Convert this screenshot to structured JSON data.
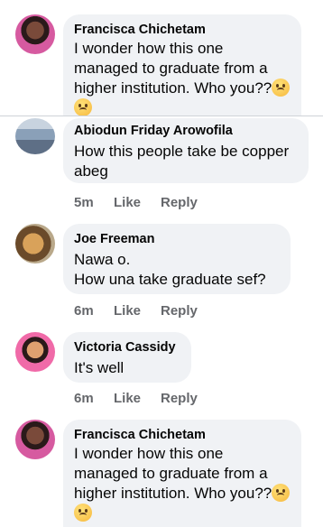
{
  "comments": [
    {
      "name": "Francisca Chichetam",
      "text": "I wonder how this one managed to graduate from a higher institution. Who you??",
      "emoji": "weary-face-emoji"
    },
    {
      "name": "Abiodun Friday Arowofila",
      "text": "How this people take be copper abeg",
      "time": "5m",
      "like": "Like",
      "reply": "Reply"
    },
    {
      "name": "Joe Freeman",
      "text": "Nawa o.\nHow una take graduate sef?",
      "time": "6m",
      "like": "Like",
      "reply": "Reply"
    },
    {
      "name": "Victoria Cassidy",
      "text": "It's well",
      "time": "6m",
      "like": "Like",
      "reply": "Reply"
    },
    {
      "name": "Francisca Chichetam",
      "text": "I wonder how this one managed to graduate from a higher institution. Who you??",
      "emoji": "weary-face-emoji"
    }
  ]
}
